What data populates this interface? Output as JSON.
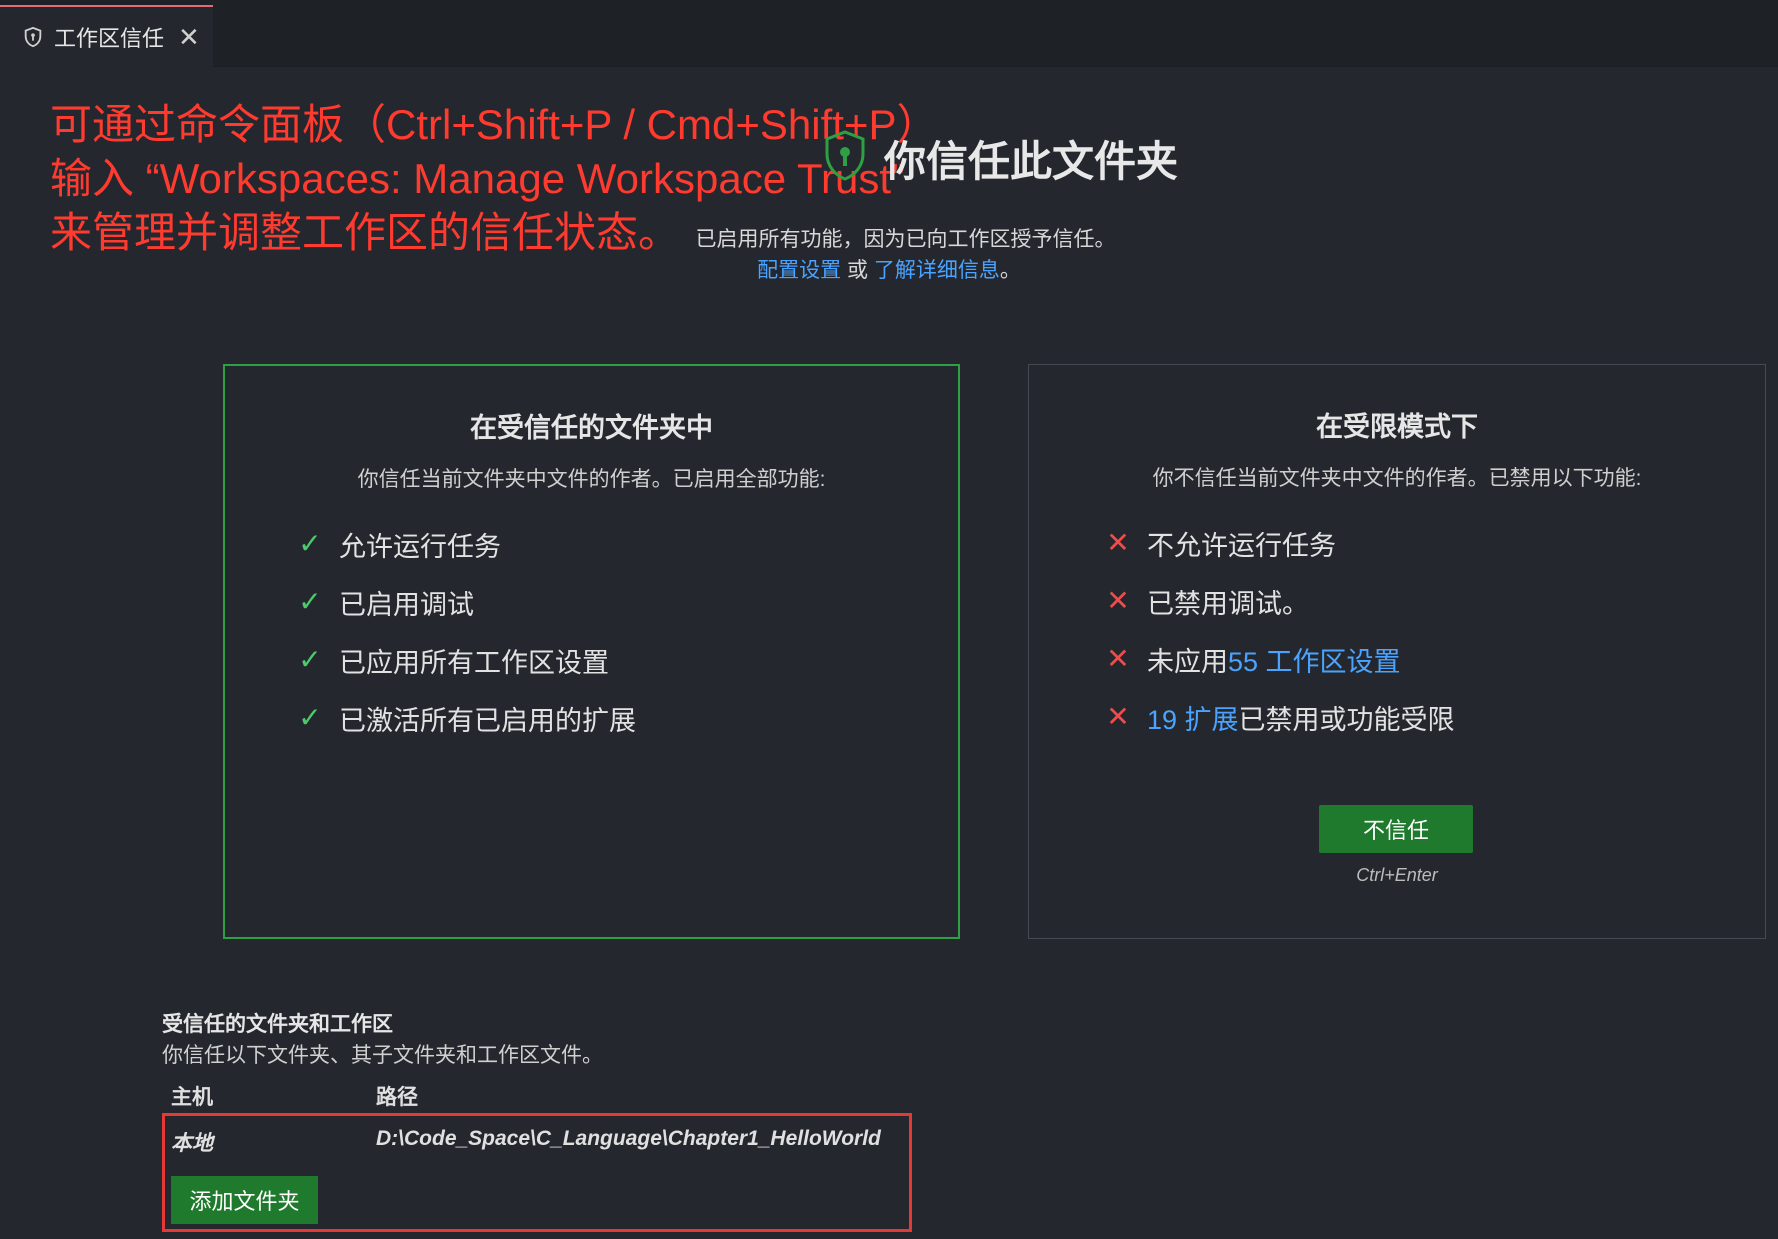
{
  "tab": {
    "label": "工作区信任",
    "close": "✕"
  },
  "annotation": {
    "line1": "可通过命令面板（Ctrl+Shift+P / Cmd+Shift+P）",
    "line2": "输入 “Workspaces: Manage Workspace Trust”",
    "line3": "来管理并调整工作区的信任状态。"
  },
  "header": {
    "title": "你信任此文件夹",
    "subtitle": "已启用所有功能，因为已向工作区授予信任。",
    "link_configure": "配置设置",
    "or_text": " 或 ",
    "link_learn": "了解详细信息",
    "end_text": "。"
  },
  "trusted_card": {
    "title": "在受信任的文件夹中",
    "description": "你信任当前文件夹中文件的作者。已启用全部功能:",
    "items": [
      "允许运行任务",
      "已启用调试",
      "已应用所有工作区设置",
      "已激活所有已启用的扩展"
    ]
  },
  "restricted_card": {
    "title": "在受限模式下",
    "description": "你不信任当前文件夹中文件的作者。已禁用以下功能:",
    "item1": "不允许运行任务",
    "item2": "已禁用调试。",
    "item3_prefix": "未应用",
    "item3_link": "55 工作区设置",
    "item4_link": "19 扩展",
    "item4_suffix": "已禁用或功能受限",
    "deny_button": "不信任",
    "shortcut": "Ctrl+Enter"
  },
  "trusted_section": {
    "title": "受信任的文件夹和工作区",
    "description": "你信任以下文件夹、其子文件夹和工作区文件。",
    "col_host": "主机",
    "col_path": "路径",
    "rows": [
      {
        "host": "本地",
        "path": "D:\\Code_Space\\C_Language\\Chapter1_HelloWorld"
      }
    ],
    "add_button": "添加文件夹"
  },
  "colors": {
    "accent_green": "#2ea043",
    "button_green": "#1f7a2d",
    "link_blue": "#4aa3ff",
    "cross_red": "#f14c4c",
    "annotation_red": "#ff3b30"
  }
}
